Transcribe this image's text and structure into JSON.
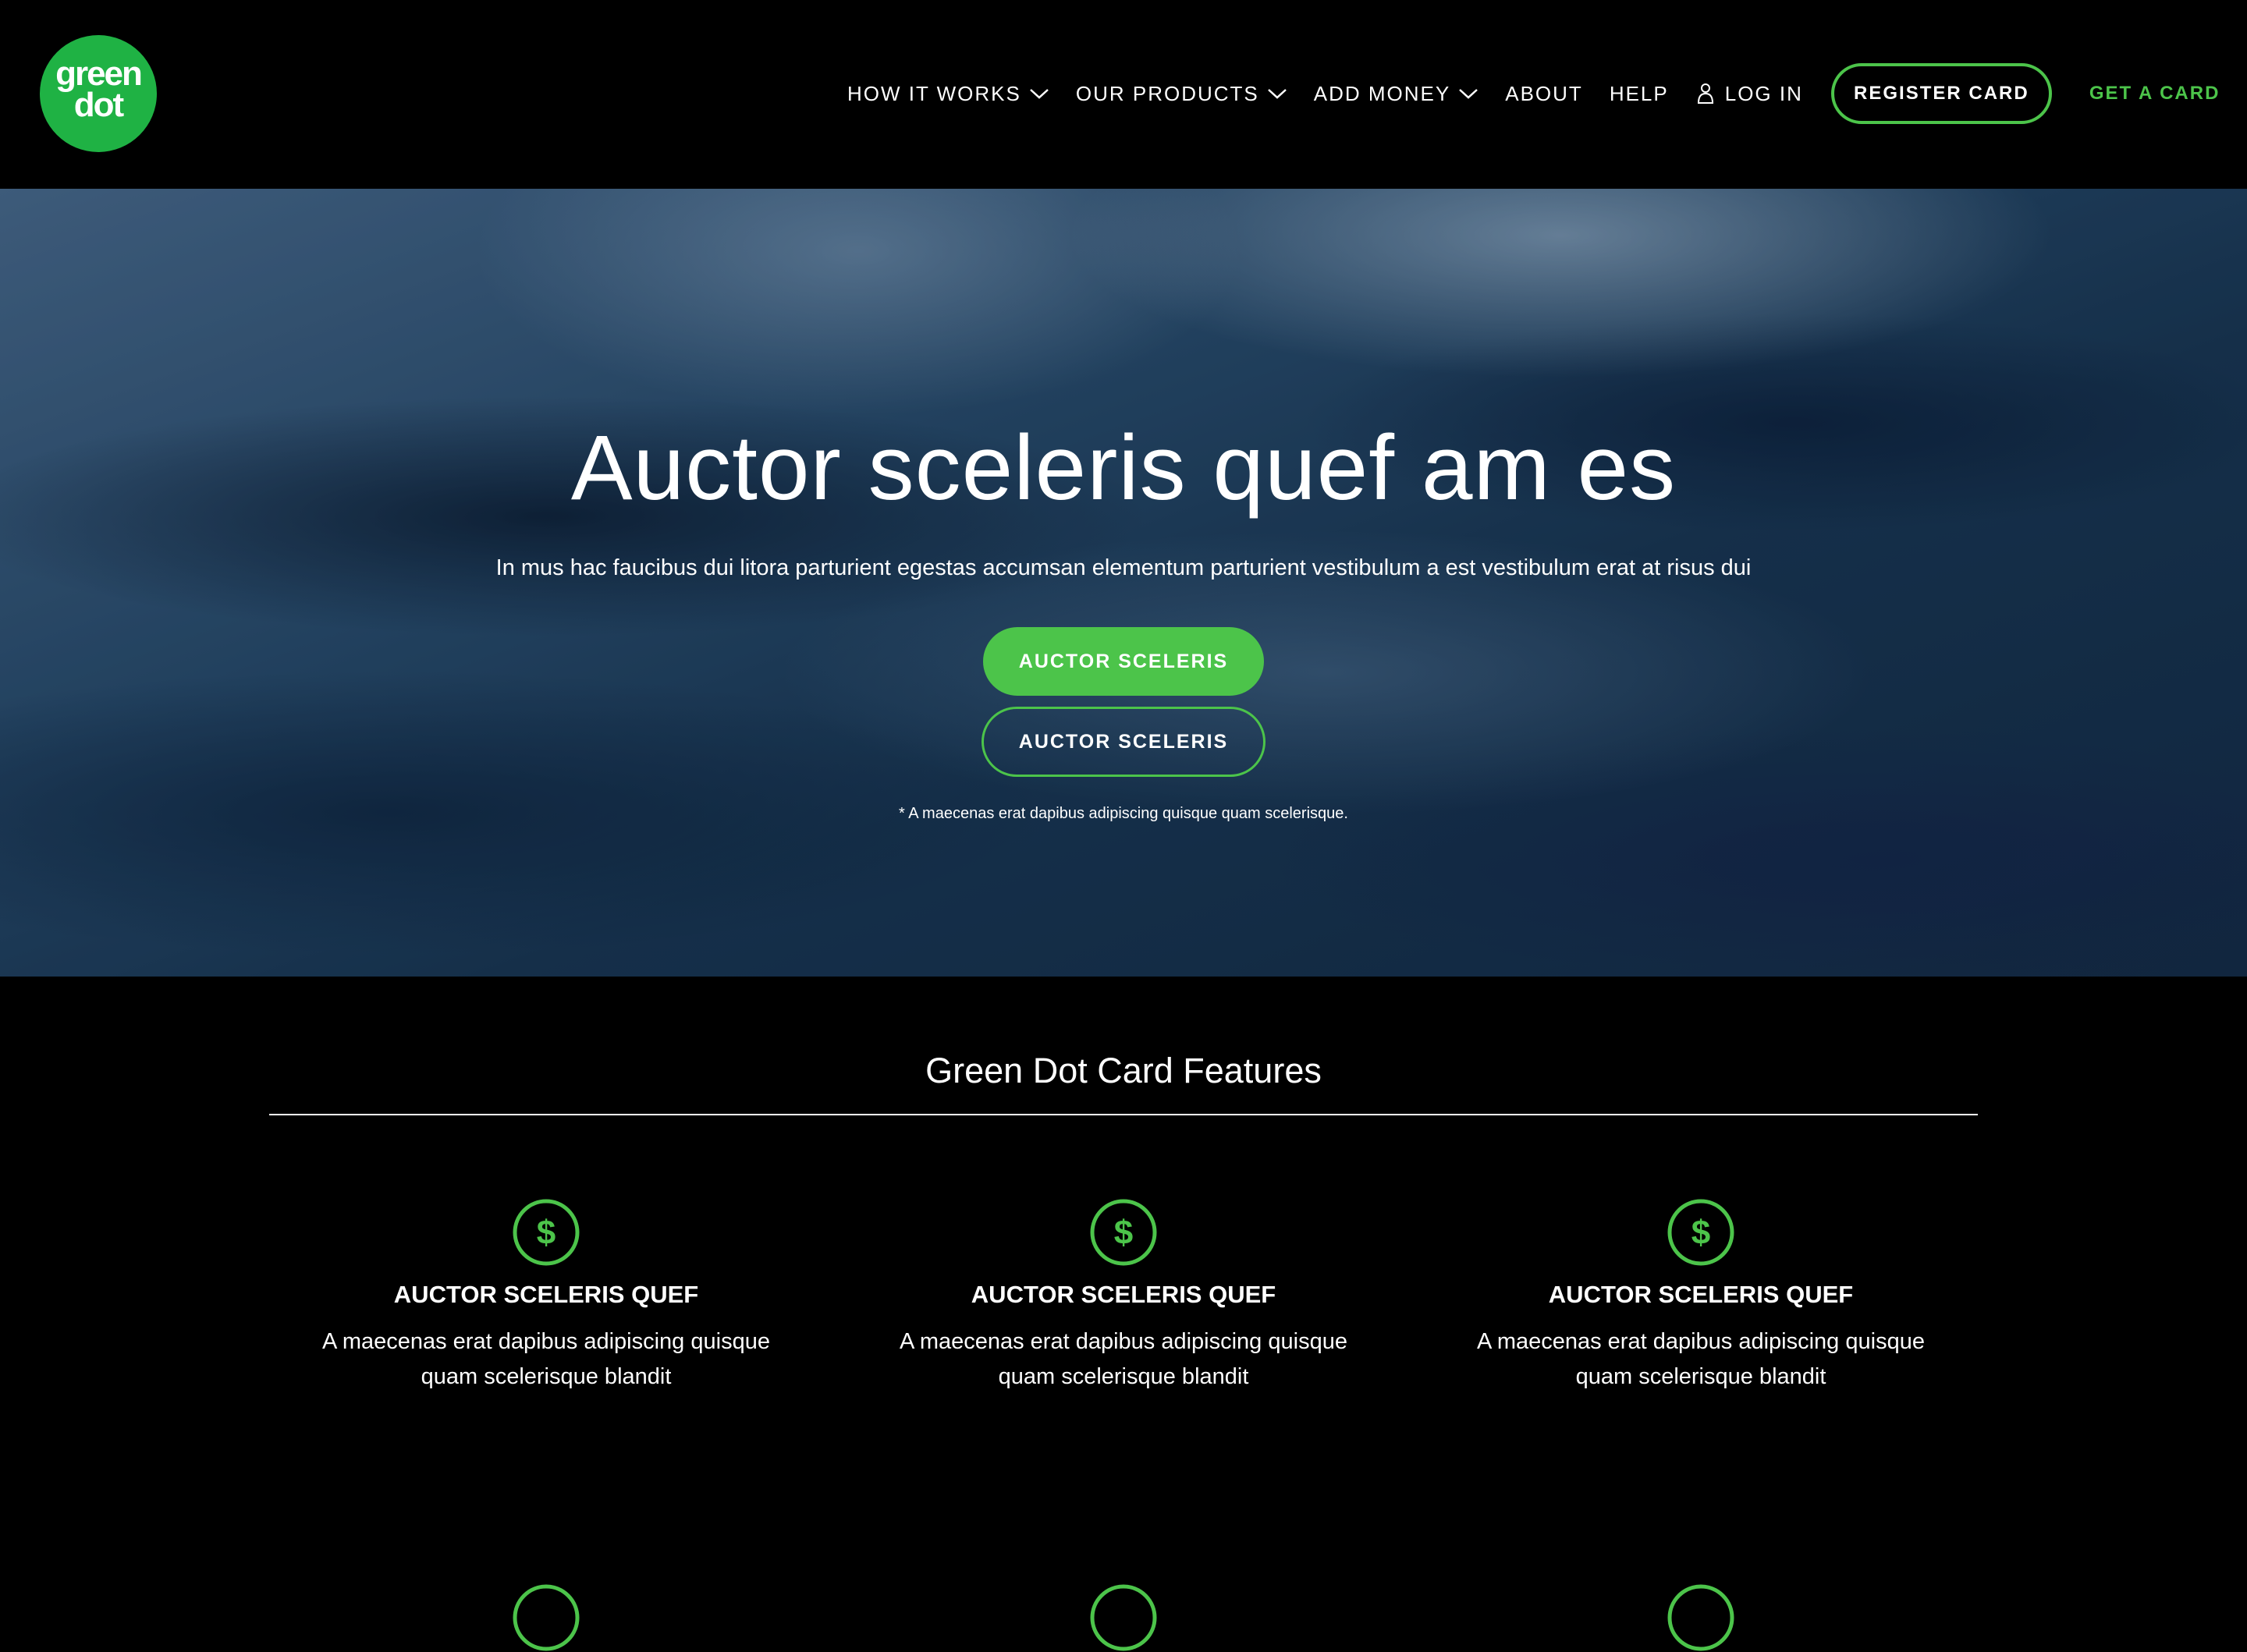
{
  "brand": {
    "logo_text": "green\ndot",
    "logo_color": "#1fb244",
    "accent": "#4cc44a"
  },
  "nav": {
    "items": [
      {
        "label": "HOW IT WORKS",
        "has_dropdown": true
      },
      {
        "label": "OUR PRODUCTS",
        "has_dropdown": true
      },
      {
        "label": "ADD MONEY",
        "has_dropdown": true
      },
      {
        "label": "ABOUT",
        "has_dropdown": false
      },
      {
        "label": "HELP",
        "has_dropdown": false
      }
    ],
    "login_label": "LOG IN",
    "register_label": "REGISTER CARD",
    "get_card_label": "GET A CARD"
  },
  "hero": {
    "title": "Auctor sceleris quef am es",
    "subtitle": "In mus hac faucibus dui litora parturient egestas accumsan elementum parturient vestibulum a est vestibulum erat at risus dui",
    "primary_button": "AUCTOR SCELERIS",
    "secondary_button": "AUCTOR SCELERIS",
    "note": "* A maecenas erat dapibus adipiscing quisque quam scelerisque."
  },
  "features": {
    "title": "Green Dot Card Features",
    "items": [
      {
        "icon": "dollar-circle-icon",
        "title": "AUCTOR SCELERIS QUEF",
        "text": "A maecenas erat dapibus adipiscing quisque quam scelerisque blandit"
      },
      {
        "icon": "dollar-circle-icon",
        "title": "AUCTOR SCELERIS QUEF",
        "text": "A maecenas erat dapibus adipiscing quisque quam scelerisque blandit"
      },
      {
        "icon": "dollar-circle-icon",
        "title": "AUCTOR SCELERIS QUEF",
        "text": "A maecenas erat dapibus adipiscing quisque quam scelerisque blandit"
      }
    ]
  }
}
